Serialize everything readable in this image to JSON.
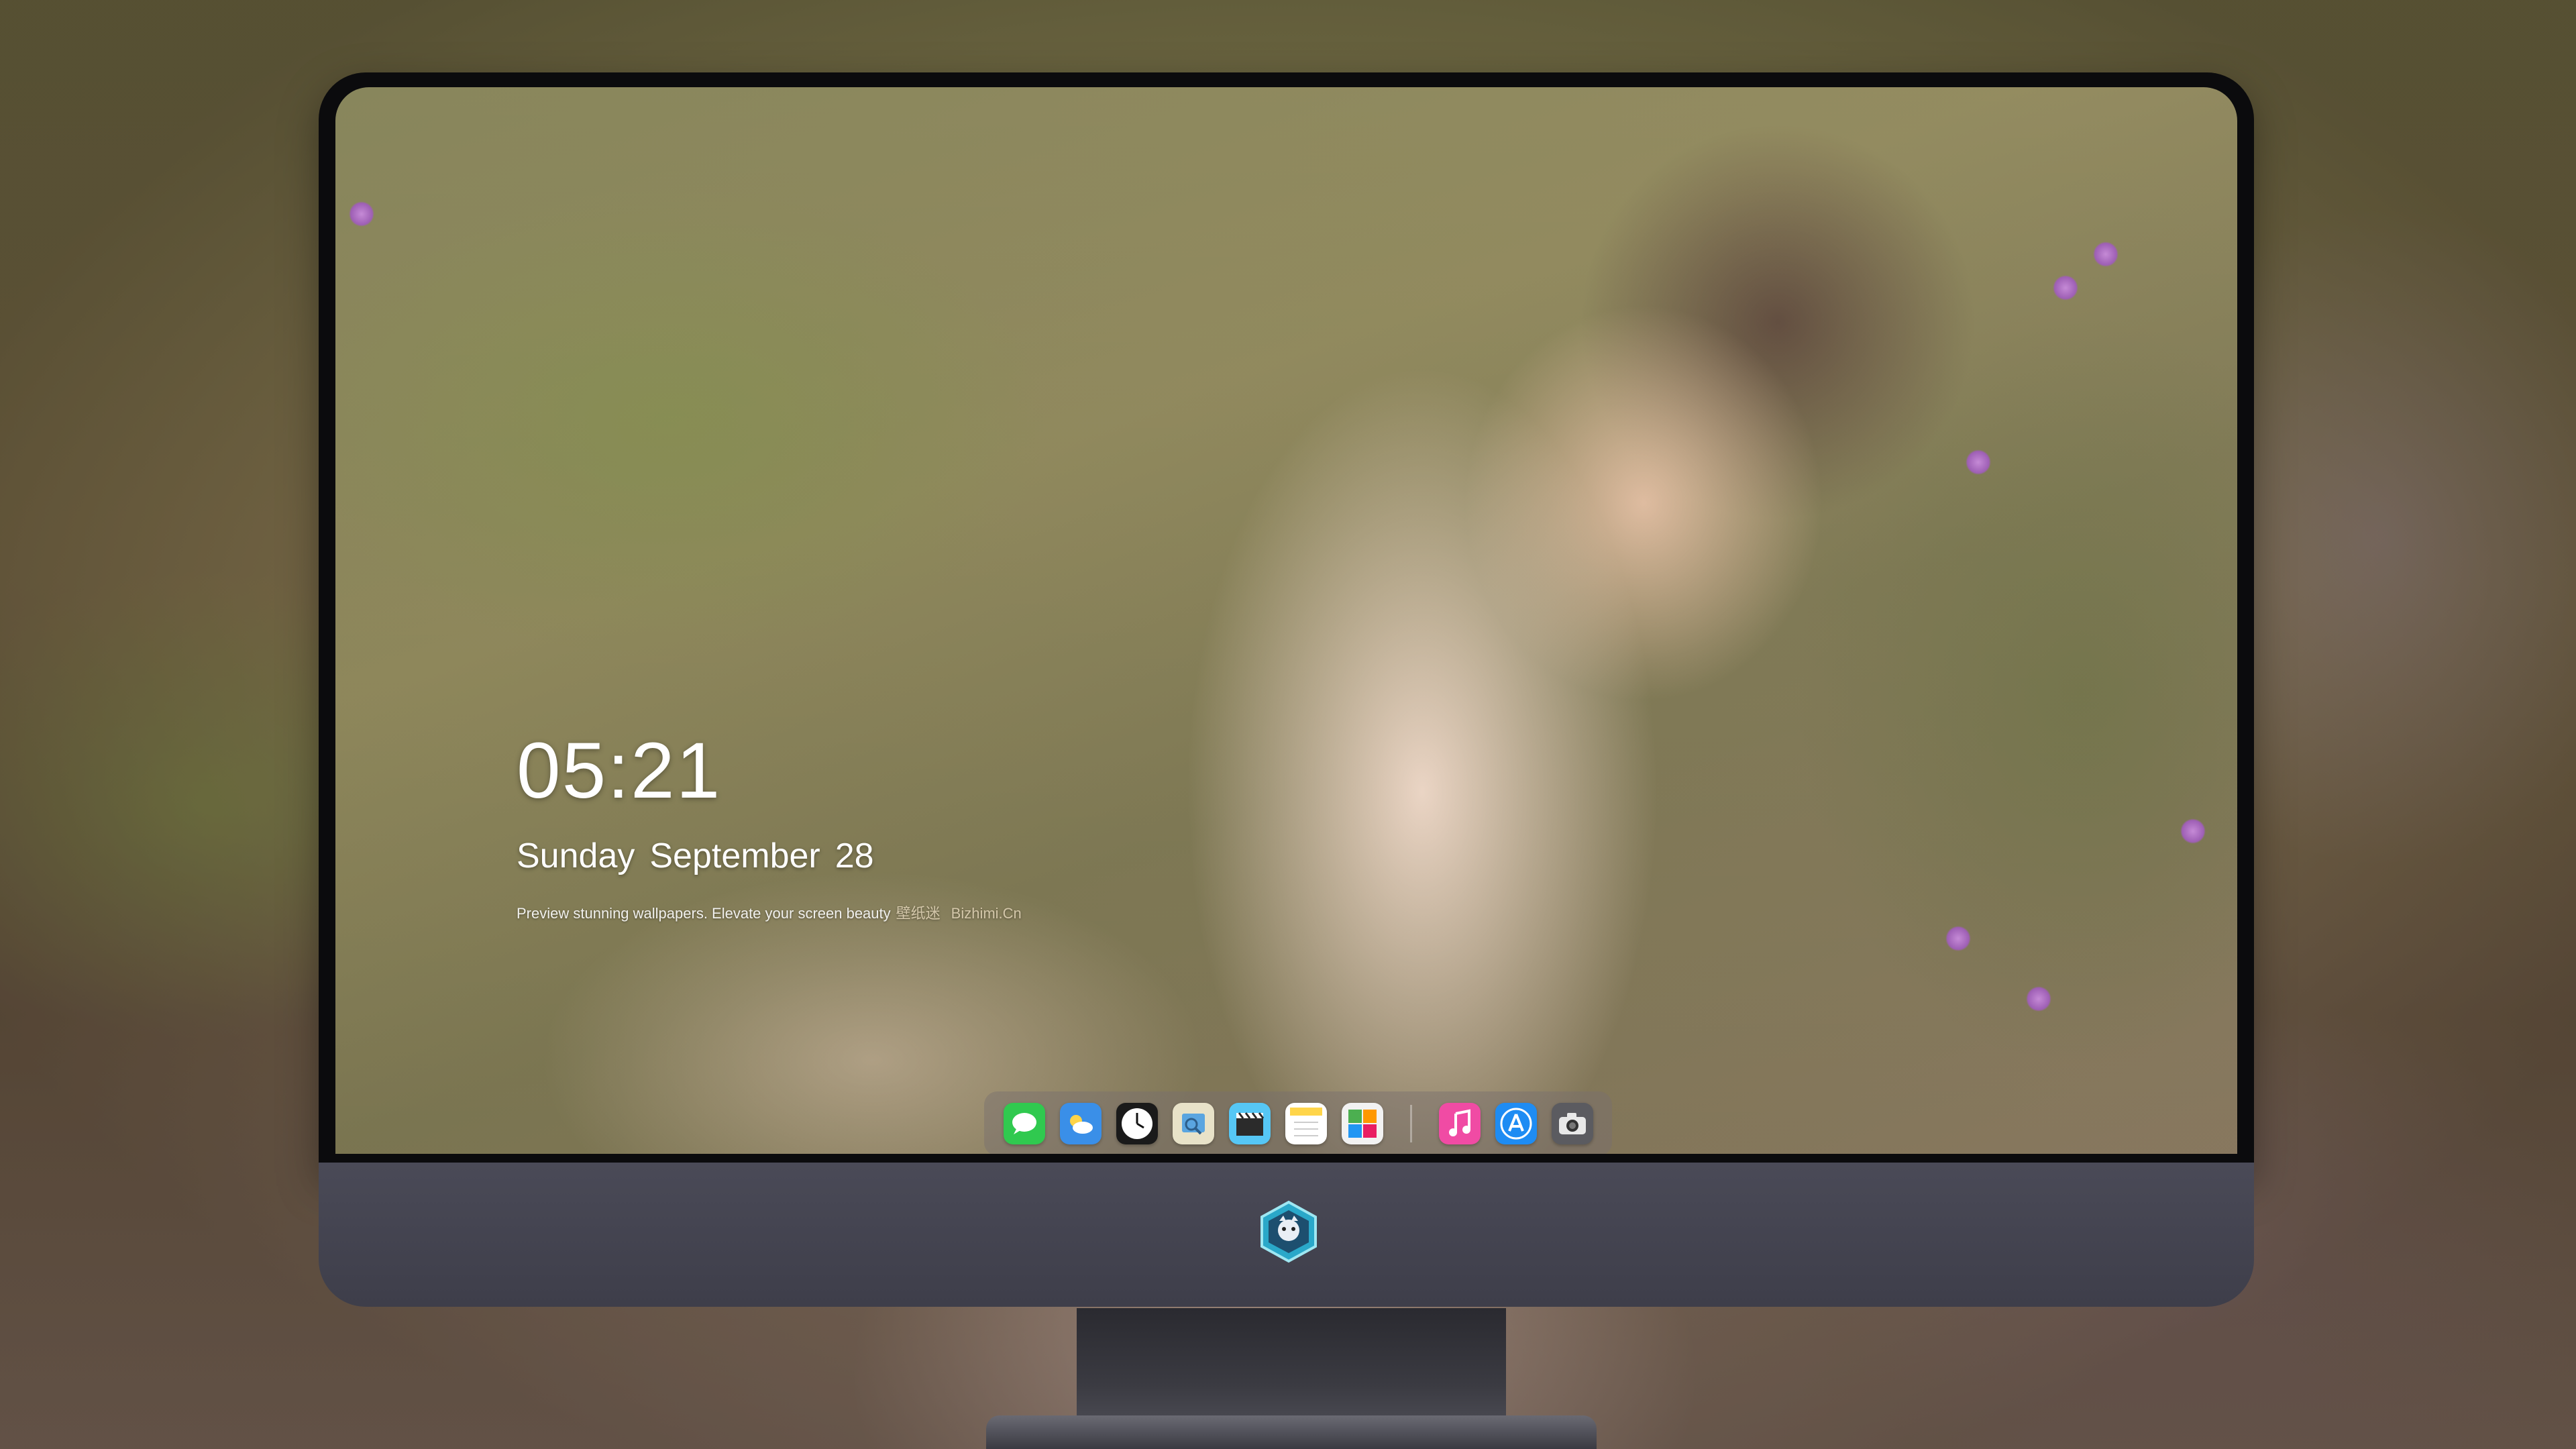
{
  "lockscreen": {
    "time": "05:21",
    "weekday": "Sunday",
    "month": "September",
    "day": "28",
    "tagline": "Preview stunning wallpapers. Elevate your screen beauty",
    "tagline_cn": "壁纸迷",
    "tagline_site": "Bizhimi.Cn"
  },
  "dock": {
    "apps": [
      {
        "name": "Messages",
        "icon": "messages-icon",
        "color": "#30c94f"
      },
      {
        "name": "Weather",
        "icon": "weather-icon",
        "color": "#3a8fe8"
      },
      {
        "name": "Clock",
        "icon": "clock-icon",
        "color": "#1a1a1a"
      },
      {
        "name": "Preview",
        "icon": "preview-icon",
        "color": "#e8e2c8"
      },
      {
        "name": "Clips",
        "icon": "clips-icon",
        "color": "#56c7f5"
      },
      {
        "name": "Notes",
        "icon": "notes-icon",
        "color": "#ffd54a"
      },
      {
        "name": "Photo Booth",
        "icon": "photobooth-icon",
        "color": "#f2f2f2"
      },
      {
        "name": "Music",
        "icon": "music-icon",
        "color": "#f04ba4"
      },
      {
        "name": "App Store",
        "icon": "appstore-icon",
        "color": "#1e8cf3"
      },
      {
        "name": "Camera",
        "icon": "camera-icon",
        "color": "#5b5b60"
      }
    ]
  },
  "colors": {
    "bezel": "#0b0b0d",
    "chin": "#44444f",
    "text": "#ffffff"
  }
}
